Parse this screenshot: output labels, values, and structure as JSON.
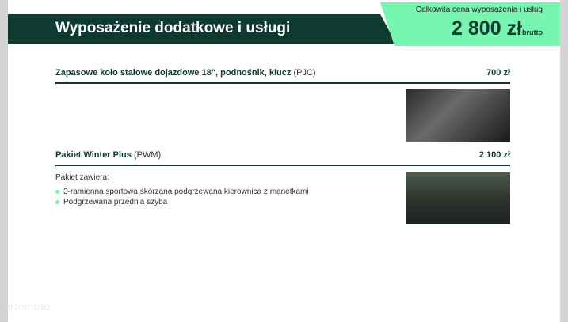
{
  "header": {
    "title": "Wyposażenie dodatkowe i usługi",
    "total_label": "Całkowita cena wyposażenia i usług",
    "total_value": "2 800 zł",
    "total_suffix": "brutto"
  },
  "items": [
    {
      "name": "Zapasowe koło stalowe dojazdowe 18\", podnośnik, klucz",
      "code": "(PJC)",
      "price": "700 zł"
    },
    {
      "name": "Pakiet Winter Plus",
      "code": "(PWM)",
      "price": "2 100 zł",
      "contents_label": "Pakiet zawiera:",
      "contents": [
        "3-ramienna sportowa skórzana podgrzewana kierownica z manetkami",
        "Podgrzewana przednia szyba"
      ]
    }
  ],
  "watermark": "otomoto"
}
